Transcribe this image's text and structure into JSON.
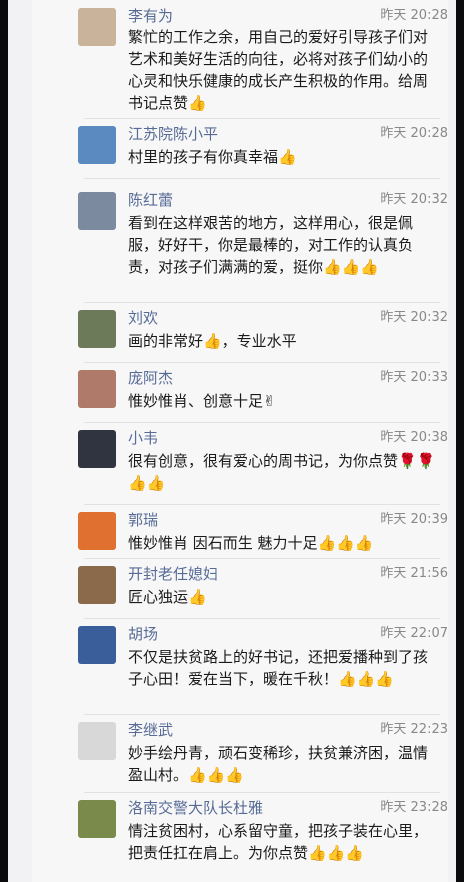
{
  "comments": [
    {
      "name": "李有为",
      "time": "昨天 20:28",
      "text": "繁忙的工作之余，用自己的爱好引导孩子们对艺术和美好生活的向往，必将对孩子们幼小的心灵和快乐健康的成长产生积极的作用。给周书记点赞👍",
      "avatar_color": "#c9b39a"
    },
    {
      "name": "江苏院陈小平",
      "time": "昨天 20:28",
      "text": "村里的孩子有你真幸福👍",
      "avatar_color": "#5a8ac0"
    },
    {
      "name": "陈红蕾",
      "time": "昨天 20:32",
      "text": "看到在这样艰苦的地方，这样用心，很是佩服，好好干，你是最棒的，对工作的认真负责，对孩子们满满的爱，挺你👍👍👍",
      "avatar_color": "#7c8aa0"
    },
    {
      "name": "刘欢",
      "time": "昨天 20:32",
      "text": "画的非常好👍，专业水平",
      "avatar_color": "#6d7a5a"
    },
    {
      "name": "庞阿杰",
      "time": "昨天 20:33",
      "text": "惟妙惟肖、创意十足✌",
      "avatar_color": "#b07a6a"
    },
    {
      "name": "小韦",
      "time": "昨天 20:38",
      "text": "很有创意，很有爱心的周书记，为你点赞🌹🌹👍👍",
      "avatar_color": "#2f3440"
    },
    {
      "name": "郭瑞",
      "time": "昨天 20:39",
      "text": "惟妙惟肖 因石而生 魅力十足👍👍👍",
      "avatar_color": "#e07030"
    },
    {
      "name": "开封老任媳妇",
      "time": "昨天 21:56",
      "text": "匠心独运👍",
      "avatar_color": "#8a6a4a"
    },
    {
      "name": "胡场",
      "time": "昨天 22:07",
      "text": "不仅是扶贫路上的好书记，还把爱播种到了孩子心田！爱在当下，暖在千秋！👍👍👍",
      "avatar_color": "#3a5e9a"
    },
    {
      "name": "李继武",
      "time": "昨天 22:23",
      "text": "妙手绘丹青，顽石变稀珍，扶贫兼济困，温情盈山村。👍👍👍",
      "avatar_color": "#d8d8d8"
    },
    {
      "name": "洛南交警大队长杜雅",
      "time": "昨天 23:28",
      "text": "情注贫困村，心系留守童，把孩子装在心里，把责任扛在肩上。为你点赞👍👍👍",
      "avatar_color": "#7a8a4a"
    }
  ]
}
